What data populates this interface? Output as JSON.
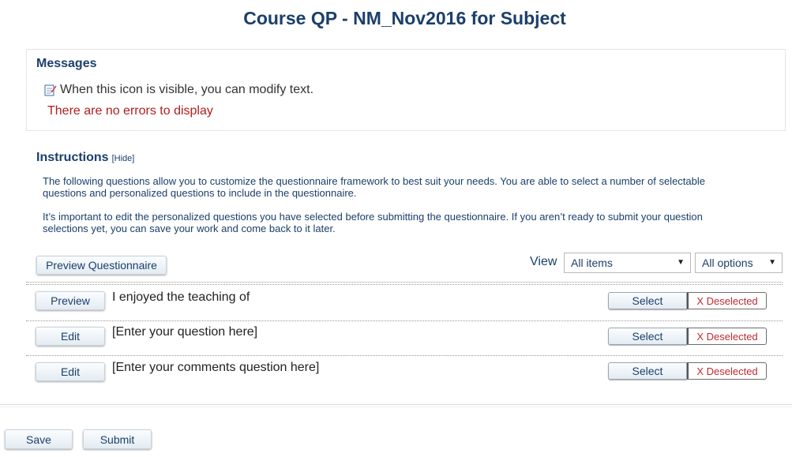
{
  "page": {
    "title": "Course QP - NM_Nov2016 for Subject"
  },
  "messages": {
    "title": "Messages",
    "edit_hint": "When this icon is visible, you can modify text.",
    "edit_icon": "edit-note-icon",
    "no_errors": "There are no errors to display",
    "error_color": "#b01e1e"
  },
  "instructions": {
    "title": "Instructions",
    "hide_link": "[Hide]",
    "paragraph1_line1": "The following questions allow you to customize the questionnaire framework to best suit your needs. You are able to select a number of selectable",
    "paragraph1_line2": "questions and personalized questions to include in the questionnaire.",
    "paragraph2_line1": "It’s important to edit the personalized questions you have selected before submitting the questionnaire. If you aren’t ready to submit your question",
    "paragraph2_line2": "selections yet, you can save your work and come back to it later."
  },
  "toolbar": {
    "preview_questionnaire_label": "Preview Questionnaire",
    "view_label": "View",
    "filter_items_value": "All items",
    "filter_options_value": "All options"
  },
  "questions": [
    {
      "action_label": "Preview",
      "text": "I enjoyed the teaching of",
      "select_label": "Select",
      "deselected_label": "X Deselected"
    },
    {
      "action_label": "Edit",
      "text": "[Enter your question here]",
      "select_label": "Select",
      "deselected_label": "X Deselected"
    },
    {
      "action_label": "Edit",
      "text": "[Enter your comments question here]",
      "select_label": "Select",
      "deselected_label": "X Deselected"
    }
  ],
  "footer": {
    "save_label": "Save",
    "submit_label": "Submit"
  },
  "colors": {
    "heading": "#1b3f6b",
    "deselected": "#c0292f"
  }
}
